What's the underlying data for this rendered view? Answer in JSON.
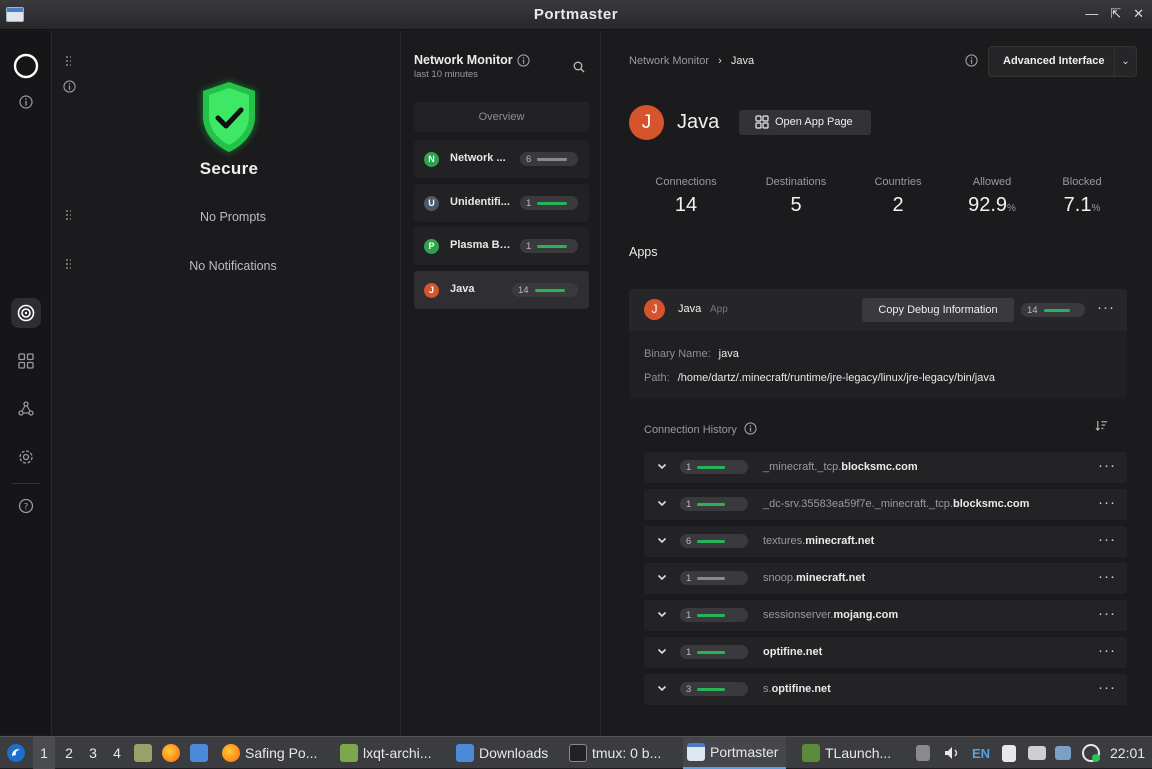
{
  "window": {
    "title": "Portmaster",
    "controls": [
      "minimize",
      "maximize",
      "close"
    ]
  },
  "rail": {
    "items": [
      "portmaster-logo-icon",
      "info-icon",
      "network-monitor-icon",
      "apps-icon",
      "spn-icon",
      "settings-icon",
      "help-icon"
    ]
  },
  "dashboard": {
    "status": "Secure",
    "no_prompts": "No Prompts",
    "no_notifications": "No Notifications"
  },
  "netlist": {
    "title": "Network Monitor",
    "subtitle": "last 10 minutes",
    "overview": "Overview",
    "apps": [
      {
        "initial": "N",
        "name": "Network ...",
        "count": "6",
        "color": "#2fa24e",
        "bar": "grey"
      },
      {
        "initial": "U",
        "name": "Unidentifi...",
        "count": "1",
        "color": "#4a5a6a",
        "bar": "green"
      },
      {
        "initial": "P",
        "name": "Plasma Br...",
        "count": "1",
        "color": "#2fa24e",
        "bar": "green"
      },
      {
        "initial": "J",
        "name": "Java",
        "count": "14",
        "color": "#d5542c",
        "bar": "green"
      }
    ]
  },
  "detail": {
    "breadcrumb": {
      "root": "Network Monitor",
      "current": "Java"
    },
    "advanced_interface": "Advanced Interface",
    "app_initial": "J",
    "app_name": "Java",
    "open_app_page": "Open App Page",
    "stats": [
      {
        "label": "Connections",
        "value": "14",
        "unit": ""
      },
      {
        "label": "Destinations",
        "value": "5",
        "unit": ""
      },
      {
        "label": "Countries",
        "value": "2",
        "unit": ""
      },
      {
        "label": "Allowed",
        "value": "92.9",
        "unit": "%"
      },
      {
        "label": "Blocked",
        "value": "7.1",
        "unit": "%"
      }
    ],
    "apps_heading": "Apps",
    "card": {
      "initial": "J",
      "name": "Java",
      "tag": "App",
      "copy_debug": "Copy Debug Information",
      "count": "14",
      "binary_label": "Binary Name:",
      "binary_value": "java",
      "path_label": "Path:",
      "path_value": "/home/dartz/.minecraft/runtime/jre-legacy/linux/jre-legacy/bin/java"
    },
    "history_title": "Connection History",
    "connections": [
      {
        "count": "1",
        "prefix": "_minecraft._tcp.",
        "domain": "blocksmc.com",
        "bar": "green"
      },
      {
        "count": "1",
        "prefix": "_dc-srv.35583ea59f7e._minecraft._tcp.",
        "domain": "blocksmc.com",
        "bar": "green"
      },
      {
        "count": "6",
        "prefix": "textures.",
        "domain": "minecraft.net",
        "bar": "green"
      },
      {
        "count": "1",
        "prefix": "snoop.",
        "domain": "minecraft.net",
        "bar": "grey"
      },
      {
        "count": "1",
        "prefix": "sessionserver.",
        "domain": "mojang.com",
        "bar": "green"
      },
      {
        "count": "1",
        "prefix": "",
        "domain": "optifine.net",
        "bar": "green"
      },
      {
        "count": "3",
        "prefix": "s.",
        "domain": "optifine.net",
        "bar": "green"
      }
    ]
  },
  "taskbar": {
    "workspaces": [
      "1",
      "2",
      "3",
      "4"
    ],
    "tasks": [
      {
        "label": "Safing Po...",
        "icon": "firefox-icon"
      },
      {
        "label": "lxqt-archi...",
        "icon": "archiver-icon"
      },
      {
        "label": "Downloads",
        "icon": "folder-icon"
      },
      {
        "label": "tmux: 0 b...",
        "icon": "terminal-icon"
      },
      {
        "label": "Portmaster",
        "icon": "portmaster-window-icon"
      },
      {
        "label": "TLaunch...",
        "icon": "minecraft-icon"
      }
    ],
    "keyboard_layout": "EN",
    "clock": "22:01"
  }
}
